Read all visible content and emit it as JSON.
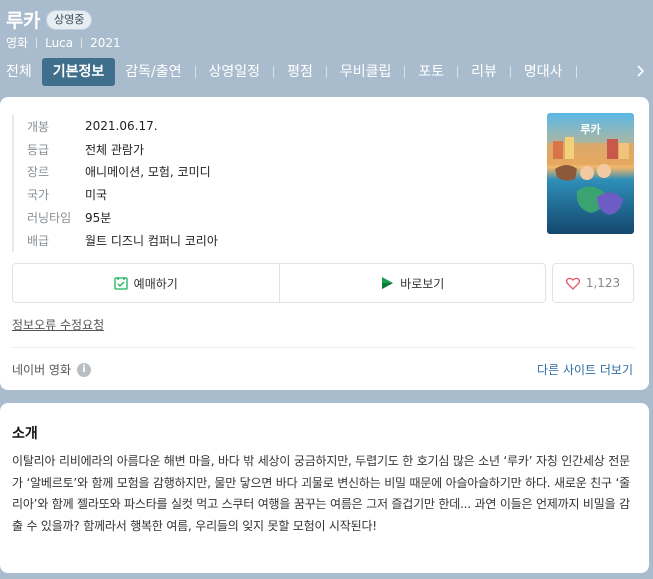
{
  "header": {
    "title": "루카",
    "status_badge": "상영중",
    "meta": [
      "영화",
      "Luca",
      "2021"
    ]
  },
  "tabs": [
    {
      "label": "전체",
      "active": false
    },
    {
      "label": "기본정보",
      "active": true
    },
    {
      "label": "감독/출연",
      "active": false
    },
    {
      "label": "상영일정",
      "active": false
    },
    {
      "label": "평점",
      "active": false
    },
    {
      "label": "무비클립",
      "active": false
    },
    {
      "label": "포토",
      "active": false
    },
    {
      "label": "리뷰",
      "active": false
    },
    {
      "label": "명대사",
      "active": false
    }
  ],
  "info": {
    "rows": [
      {
        "key": "개봉",
        "value": "2021.06.17."
      },
      {
        "key": "등급",
        "value": "전체 관람가"
      },
      {
        "key": "장르",
        "value": "애니메이션, 모험, 코미디"
      },
      {
        "key": "국가",
        "value": "미국"
      },
      {
        "key": "러닝타임",
        "value": "95분"
      },
      {
        "key": "배급",
        "value": "월트 디즈니 컴퍼니 코리아"
      }
    ],
    "poster_title": "루카"
  },
  "actions": {
    "reserve_label": "예매하기",
    "watch_label": "바로보기",
    "like_count": "1,123"
  },
  "links": {
    "report": "정보오류 수정요청",
    "source": "네이버 영화",
    "other_sites": "다른 사이트 더보기"
  },
  "intro": {
    "title": "소개",
    "text": "이탈리아 리비에라의 아름다운 해변 마을, 바다 밖 세상이 궁금하지만, 두렵기도 한 호기심 많은 소년 ‘루카’ 자칭 인간세상 전문가 ‘알베르토’와 함께 모험을 감행하지만, 물만 닿으면 바다 괴물로 변신하는 비밀 때문에 아슬아슬하기만 하다. 새로운 친구 ‘줄리아’와 함께 젤라또와 파스타를 실컷 먹고 스쿠터 여행을 꿈꾸는 여름은 그저 즐겁기만 한데... 과연 이들은 언제까지 비밀을 감출 수 있을까? 함께라서 행복한 여름, 우리들의 잊지 못할 모험이 시작된다!"
  },
  "colors": {
    "header_bg": "#a9bccd",
    "active_tab": "#3f6f8c",
    "link_blue": "#2e6ea6",
    "reserve_green": "#19b35a",
    "heart": "#e05a6a"
  }
}
